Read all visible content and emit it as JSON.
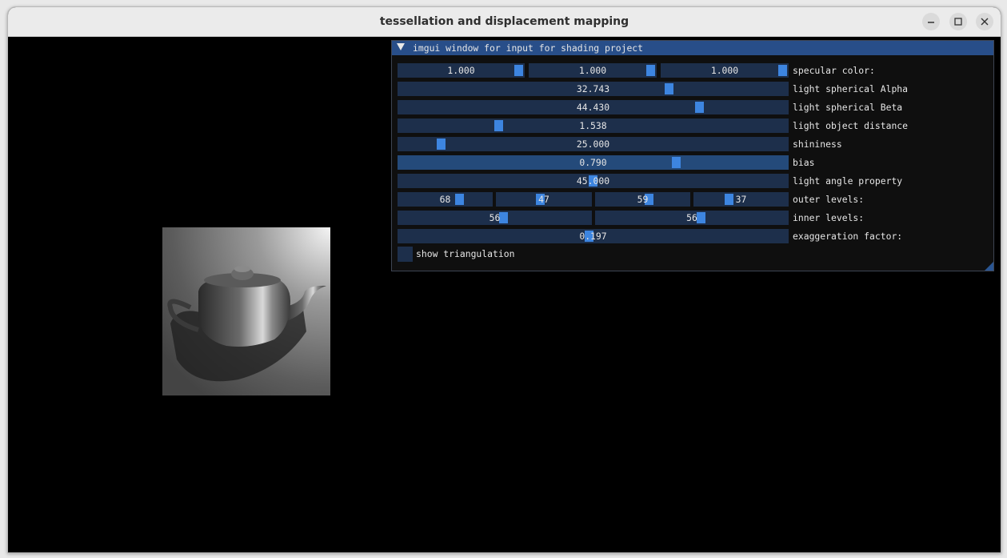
{
  "window": {
    "title": "tessellation and displacement mapping"
  },
  "panel": {
    "title": "imgui window for input for shading project",
    "specular": {
      "label": "specular color:",
      "values": [
        "1.000",
        "1.000",
        "1.000"
      ],
      "levels": [
        1.0,
        1.0,
        1.0
      ]
    },
    "light_alpha": {
      "label": "light spherical Alpha",
      "value": "32.743",
      "level": 0.7
    },
    "light_beta": {
      "label": "light spherical Beta",
      "value": "44.430",
      "level": 0.78
    },
    "light_distance": {
      "label": "light object distance",
      "value": "1.538",
      "level": 0.25
    },
    "shininess": {
      "label": "shininess",
      "value": "25.000",
      "level": 0.1
    },
    "bias": {
      "label": "bias",
      "value": "0.790",
      "level": 0.72
    },
    "light_angle": {
      "label": "light angle property",
      "value": "45.000",
      "level": 0.5
    },
    "outer_levels": {
      "label": "outer levels:",
      "values": [
        "68",
        "47",
        "59",
        "37"
      ],
      "levels": [
        0.67,
        0.46,
        0.58,
        0.36
      ]
    },
    "inner_levels": {
      "label": "inner levels:",
      "values": [
        "56",
        "56"
      ],
      "levels": [
        0.55,
        0.55
      ]
    },
    "exaggeration": {
      "label": "exaggeration factor:",
      "value": "0.197",
      "level": 0.49
    },
    "show_triangulation": {
      "label": "show triangulation",
      "checked": false
    }
  },
  "colors": {
    "header": "#284e89",
    "slider_bg": "#1d2f4b",
    "slider_active_bg": "#244a7a",
    "grab": "#3d85e0",
    "viewport": "#000000"
  },
  "icons": [
    "minimize-icon",
    "maximize-icon",
    "close-icon",
    "collapse-arrow-icon",
    "resize-grip-icon"
  ]
}
